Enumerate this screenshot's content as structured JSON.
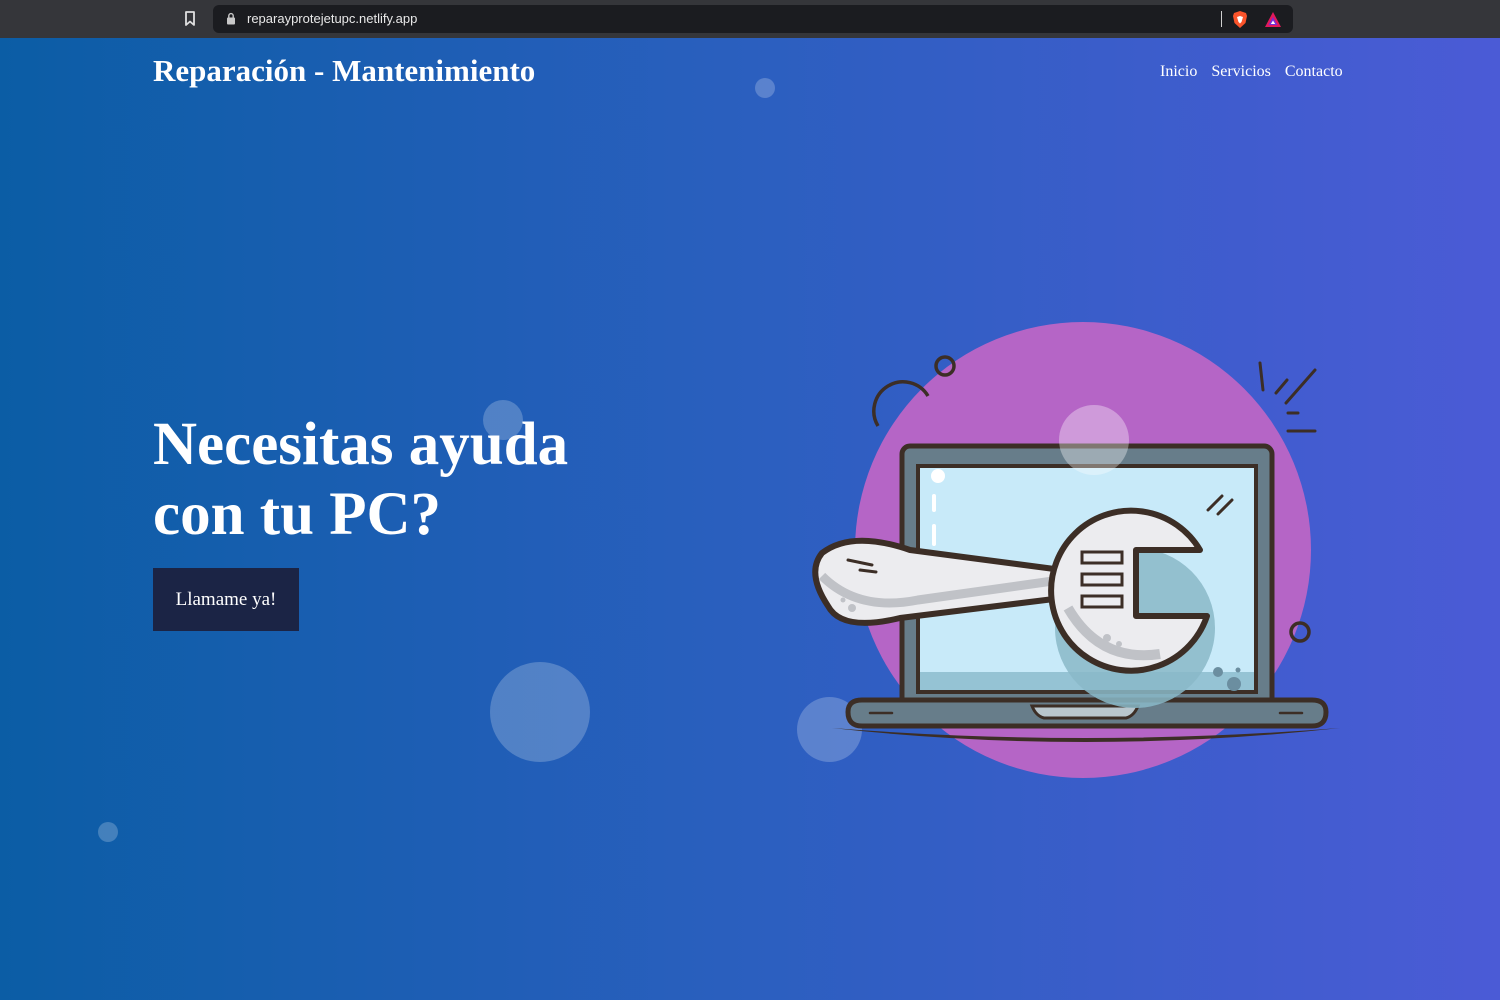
{
  "browser": {
    "url": "reparayprotejetupc.netlify.app"
  },
  "header": {
    "title": "Reparación - Mantenimiento",
    "nav": [
      "Inicio",
      "Servicios",
      "Contacto"
    ]
  },
  "hero": {
    "heading": "Necesitas ayuda con tu PC?",
    "button_label": "Llamame ya!"
  },
  "colors": {
    "gradient_start": "#0b5da5",
    "gradient_end": "#4b5bd6",
    "button_bg": "#1b2445",
    "illustration_circle": "#b565c6"
  },
  "icons": [
    "bookmark-icon",
    "lock-icon",
    "brave-shield-icon",
    "brave-rewards-icon",
    "laptop-wrench-illustration"
  ]
}
